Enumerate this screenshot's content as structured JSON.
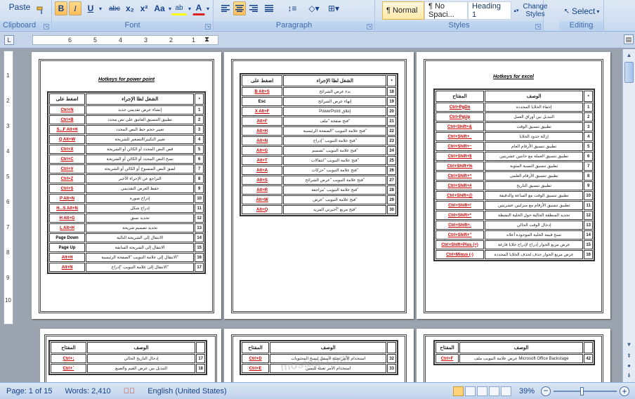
{
  "ribbon": {
    "clipboard": {
      "paste_label": "Paste",
      "group_label": "Clipboard"
    },
    "font": {
      "group_label": "Font",
      "bold": "B",
      "italic": "I",
      "underline": "U",
      "strikethrough": "abc",
      "subscript": "x₂",
      "superscript": "x²",
      "change_case": "Aa",
      "highlight": "ab",
      "font_color": "A"
    },
    "paragraph": {
      "group_label": "Paragraph"
    },
    "styles": {
      "group_label": "Styles",
      "items": [
        "¶ Normal",
        "¶ No Spaci...",
        "Heading 1"
      ],
      "change_styles": "Change Styles"
    },
    "editing": {
      "group_label": "Editing",
      "select": "Select"
    }
  },
  "ruler": {
    "ticks": [
      "6",
      "5",
      "4",
      "3",
      "2",
      "1"
    ],
    "vticks": [
      "1",
      "2",
      "3",
      "4",
      "5",
      "6",
      "7",
      "8",
      "9",
      "10"
    ]
  },
  "pages": {
    "p1": {
      "title": "Hotkeys for power point",
      "headers": {
        "action": "الشغل لظا الإجراء",
        "key": "اضغط على",
        "num": "•"
      },
      "rows": [
        {
          "n": "1",
          "a": "إنشاء عرض تقديمي جديد",
          "k": "Ctrl+N",
          "red": true
        },
        {
          "n": "2",
          "a": "تطبيق التنسيق الغامق على نص محدد",
          "k": "Ctrl+B",
          "red": true
        },
        {
          "n": "3",
          "a": "تغيير حجم خط النص المحدد",
          "k": "S...F  Alt+H",
          "red": true
        },
        {
          "n": "4",
          "a": "تغيير التكبير/التصغير للشريحة",
          "k": "Q  Alt+W",
          "red": true
        },
        {
          "n": "5",
          "a": "قص النص المحدد أو الكائن أو الشريحة",
          "k": "Ctrl+X",
          "red": true
        },
        {
          "n": "6",
          "a": "نسخ النص المحدد أو الكائن أو الشريحة",
          "k": "Ctrl+C",
          "red": true
        },
        {
          "n": "7",
          "a": "لصق النص المنسوخ أو الكائن أو الشريحة",
          "k": "Ctrl+V",
          "red": true
        },
        {
          "n": "8",
          "a": "التراجع عن الإجراء الأخير",
          "k": "Ctrl+Z",
          "red": true
        },
        {
          "n": "9",
          "a": "حفظ العرض التقديمي",
          "k": "Ctrl+S",
          "red": true
        },
        {
          "n": "10",
          "a": "إدراج صورة",
          "k": "P  Alt+N",
          "red": true
        },
        {
          "n": "11",
          "a": "إدراج شكل",
          "k": "H...S  Alt+N",
          "red": true
        },
        {
          "n": "12",
          "a": "تحديد نسق",
          "k": "H  Alt+G",
          "red": true
        },
        {
          "n": "13",
          "a": "تحديد تصميم شريحة",
          "k": "L  Alt+H",
          "red": true
        },
        {
          "n": "14",
          "a": "الانتقال إلى الشريحة التالية",
          "k": "Page Down",
          "red": false
        },
        {
          "n": "15",
          "a": "الانتقال إلى الشريحة السابقة",
          "k": "Page Up",
          "red": false
        },
        {
          "n": "16",
          "a": "الانتقال إلى علامة التبويب \"الصفحة الرئيسية\"",
          "k": "Alt+H",
          "red": true
        },
        {
          "n": "17",
          "a": "الانتقال إلى علامة التبويب \"إدراج\"",
          "k": "Alt+N",
          "red": true
        }
      ]
    },
    "p2": {
      "headers": {
        "action": "الشغل لظا الإجراء",
        "key": "اضغط على",
        "num": "•"
      },
      "rows": [
        {
          "n": "18",
          "a": "بدء عرض الشرائح",
          "k": "B  Alt+S",
          "red": true
        },
        {
          "n": "19",
          "a": "إنهاء عرض الشرائح",
          "k": "Esc",
          "red": false
        },
        {
          "n": "20",
          "a": "PowerPoint إغلاق",
          "k": "X  Alt+F",
          "red": true
        },
        {
          "n": "21",
          "a": "فتح صفحة \"ملف\"",
          "k": "Alt+F",
          "red": true
        },
        {
          "n": "22",
          "a": "فتح علامة التبويب \"الصفحة الرئيسية\"",
          "k": "Alt+H",
          "red": true
        },
        {
          "n": "23",
          "a": "فتح علامة التبويب \"إدراج\"",
          "k": "Alt+N",
          "red": true
        },
        {
          "n": "24",
          "a": "فتح علامة التبويب \"تصميم\"",
          "k": "Alt+G",
          "red": true
        },
        {
          "n": "25",
          "a": "فتح علامة التبويب \"انتقالات\"",
          "k": "Alt+T",
          "red": true
        },
        {
          "n": "26",
          "a": "فتح علامة التبويب \"حركات\"",
          "k": "Alt+A",
          "red": true
        },
        {
          "n": "27",
          "a": "فتح علامة التبويب \"عرض الشرائح\"",
          "k": "Alt+S",
          "red": true
        },
        {
          "n": "28",
          "a": "فتح علامة التبويب \"مراجعة\"",
          "k": "Alt+R",
          "red": true
        },
        {
          "n": "29",
          "a": "فتح علامة التبويب \"عرض\"",
          "k": "Alt+W",
          "red": true
        },
        {
          "n": "30",
          "a": "فتح مربع \"أخبرني المزيد\"",
          "k": "Alt+Q",
          "red": true
        }
      ]
    },
    "p3": {
      "title": "Hotkeys for excel",
      "headers": {
        "key": "المفتاح",
        "desc": "الوصف",
        "num": "•"
      },
      "rows": [
        {
          "n": "1",
          "d": "إخفاء الخلايا المحددة",
          "k": "Ctrl+PgDn"
        },
        {
          "n": "2",
          "d": "التبديل بين أوراق العمل",
          "k": "Ctrl+PgUp"
        },
        {
          "n": "3",
          "d": "تطبيق تنسيق الوقت",
          "k": "Ctrl+Shift+&"
        },
        {
          "n": "4",
          "d": "إزالة حدود الخلايا",
          "k": "Ctrl+Shift+_"
        },
        {
          "n": "5",
          "d": "تطبيق تنسيق الأرقام العام",
          "k": "Ctrl+Shift+~"
        },
        {
          "n": "6",
          "d": "تطبيق تنسيق العملة مع خانتين عشريتين",
          "k": "Ctrl+Shift+$"
        },
        {
          "n": "7",
          "d": "تطبيق تنسيق النسبة المئوية",
          "k": "Ctrl+Shift+%"
        },
        {
          "n": "8",
          "d": "تطبيق تنسيق الأرقام العلمي",
          "k": "Ctrl+Shift+^"
        },
        {
          "n": "9",
          "d": "تطبيق تنسيق التاريخ",
          "k": "Ctrl+Shift+#"
        },
        {
          "n": "10",
          "d": "تطبيق تنسيق الوقت مع الساعة والدقيقة",
          "k": "Ctrl+Shift+@"
        },
        {
          "n": "11",
          "d": "تطبيق تنسيق الأرقام مع منزلتين عشريتين",
          "k": "Ctrl+Shift+!"
        },
        {
          "n": "12",
          "d": "تحديد المنطقة الحالية حول الخلية النشطة",
          "k": "Ctrl+Shift+*"
        },
        {
          "n": "13",
          "d": "إدخال الوقت الحالي",
          "k": "Ctrl+Shift+:"
        },
        {
          "n": "14",
          "d": "نسخ قيمة الخلية الموجودة أعلاه",
          "k": "Ctrl+Shift+\""
        },
        {
          "n": "15",
          "d": "عرض مربع الحوار إدراج لإدراج خلايا فارغة",
          "k": "Ctrl+Shift+Plus (+)"
        },
        {
          "n": "16",
          "d": "عرض مربع الحوار حذف لحذف الخلايا المحددة",
          "k": "Ctrl+Minus (-)"
        }
      ]
    },
    "p4": {
      "headers": {
        "key": "المفتاح",
        "desc": "الوصف"
      },
      "rows": [
        {
          "n": "17",
          "d": "إدخال التاريخ الحالي",
          "k": "Ctrl+;"
        },
        {
          "n": "18",
          "d": "التبديل بين عرض القيم والصيغ",
          "k": "Ctrl+`"
        }
      ]
    },
    "p5": {
      "headers": {
        "key": "المفتاح",
        "desc": "الوصف"
      },
      "rows": [
        {
          "n": "32",
          "d": "استخدام الأمر تعبئة لأسفل لنسخ المحتويات",
          "k": "Ctrl+D"
        },
        {
          "n": "33",
          "d": "استخدام الأمر تعبئة لليمين",
          "k": "Ctrl+E"
        }
      ]
    },
    "p6": {
      "headers": {
        "key": "المفتاح",
        "desc": "الوصف"
      },
      "rows": [
        {
          "n": "42",
          "d": "عرض علامة التبويب ملف Microsoft Office Backstage",
          "k": "Ctrl+F"
        }
      ]
    }
  },
  "watermark": "mostaql.com",
  "status": {
    "page": "Page: 1 of 15",
    "words": "Words: 2,410",
    "language": "English (United States)",
    "zoom": "39%"
  }
}
